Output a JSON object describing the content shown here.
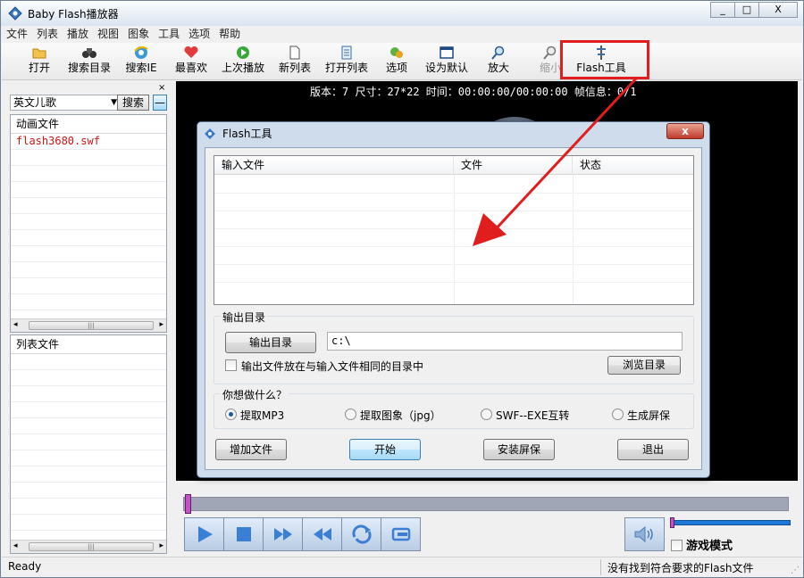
{
  "window": {
    "title": "Baby Flash播放器",
    "buttons": [
      "_",
      "□",
      "X"
    ]
  },
  "menu": [
    "文件",
    "列表",
    "播放",
    "视图",
    "图象",
    "工具",
    "选项",
    "帮助"
  ],
  "toolbar": [
    {
      "label": "打开",
      "icon": "folder-open-icon"
    },
    {
      "label": "搜索目录",
      "icon": "binoculars-icon"
    },
    {
      "label": "搜索IE",
      "icon": "ie-icon"
    },
    {
      "label": "最喜欢",
      "icon": "heart-icon"
    },
    {
      "label": "上次播放",
      "icon": "play-circle-icon"
    },
    {
      "label": "新列表",
      "icon": "new-document-icon"
    },
    {
      "label": "打开列表",
      "icon": "list-icon"
    },
    {
      "label": "选项",
      "icon": "options-icon"
    },
    {
      "label": "设为默认",
      "icon": "window-icon"
    },
    {
      "label": "放大",
      "icon": "zoom-in-icon"
    },
    {
      "label": "缩小",
      "icon": "zoom-out-icon"
    },
    {
      "label": "Flash工具",
      "icon": "tools-icon"
    }
  ],
  "left_panel": {
    "close": "×",
    "category": "英文儿歌",
    "search_button": "搜索",
    "extra_button": "—",
    "anim_header": "动画文件",
    "anim_files": [
      "flash3680.swf"
    ],
    "list_header": "列表文件",
    "scroll_left": "◂",
    "scroll_right": "▸",
    "scroll_grip": "|||"
  },
  "info": "版本：7   尺寸：27*22   时间：00:00:00/00:00:00   帧信息：0/1",
  "dialog": {
    "title": "Flash工具",
    "close": "x",
    "columns": [
      "输入文件",
      "文件",
      "状态"
    ],
    "output_group": "输出目录",
    "output_button": "输出目录",
    "output_path": "c:\\",
    "same_dir_label": "输出文件放在与输入文件相同的目录中",
    "browse_button": "浏览目录",
    "action_group": "你想做什么？",
    "options": [
      {
        "label": "提取MP3",
        "selected": true
      },
      {
        "label": "提取图象（jpg）",
        "selected": false
      },
      {
        "label": "SWF--EXE互转",
        "selected": false
      },
      {
        "label": "生成屏保",
        "selected": false
      }
    ],
    "add_button": "增加文件",
    "start_button": "开始",
    "install_button": "安装屏保",
    "exit_button": "退出"
  },
  "player": {
    "game_mode": "游戏模式",
    "progress": 0,
    "volume": 0
  },
  "status": {
    "left": "Ready",
    "right": "没有找到符合要求的Flash文件"
  },
  "colors": {
    "highlight": "#e11e1e",
    "arrow": "#e11e1e",
    "selected_file": "#d01414"
  }
}
